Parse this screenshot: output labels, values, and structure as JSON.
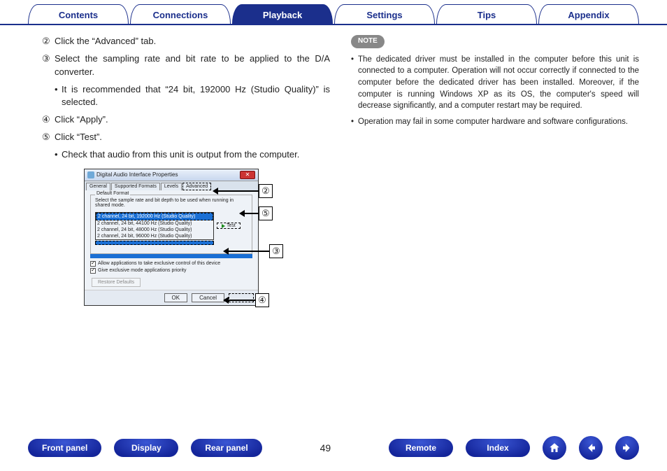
{
  "topnav": {
    "tabs": [
      "Contents",
      "Connections",
      "Playback",
      "Settings",
      "Tips",
      "Appendix"
    ],
    "active": 2
  },
  "steps": {
    "s2_num": "②",
    "s2": "Click the “Advanced” tab.",
    "s3_num": "③",
    "s3": "Select the sampling rate and bit rate to be applied to the D/A converter.",
    "s3_bullet": "It is recommended that “24 bit, 192000 Hz (Studio Quality)” is selected.",
    "s4_num": "④",
    "s4": "Click “Apply”.",
    "s5_num": "⑤",
    "s5": "Click “Test”.",
    "s5_bullet": "Check that audio from this unit is output from the computer."
  },
  "note": {
    "badge": "NOTE",
    "n1": "The dedicated driver must be installed in the computer before this unit is connected to a computer. Operation will not occur correctly if connected to the computer before the dedicated driver has been installed. Moreover, if the computer is running Windows XP as its OS, the computer's speed will decrease significantly, and a computer restart may be required.",
    "n2": "Operation may fail in some computer hardware and software configurations."
  },
  "dialog": {
    "title": "Digital Audio Interface Properties",
    "tabs": [
      "General",
      "Supported Formats",
      "Levels",
      "Advanced"
    ],
    "legend": "Default Format",
    "desc": "Select the sample rate and bit depth to be used when running in shared mode.",
    "options": [
      "2 channel, 24 bit, 192000 Hz (Studio Quality)",
      "2 channel, 24 bit, 44100 Hz (Studio Quality)",
      "2 channel, 24 bit, 48000 Hz (Studio Quality)",
      "2 channel, 24 bit, 96000 Hz (Studio Quality)"
    ],
    "test": "Test",
    "chk1": "Allow applications to take exclusive control of this device",
    "chk2": "Give exclusive mode applications priority",
    "restore": "Restore Defaults",
    "ok": "OK",
    "cancel": "Cancel",
    "apply": ""
  },
  "callouts": {
    "c2": "②",
    "c3": "③",
    "c4": "④",
    "c5": "⑤"
  },
  "bottom": {
    "front": "Front panel",
    "display": "Display",
    "rear": "Rear panel",
    "page": "49",
    "remote": "Remote",
    "index": "Index"
  }
}
